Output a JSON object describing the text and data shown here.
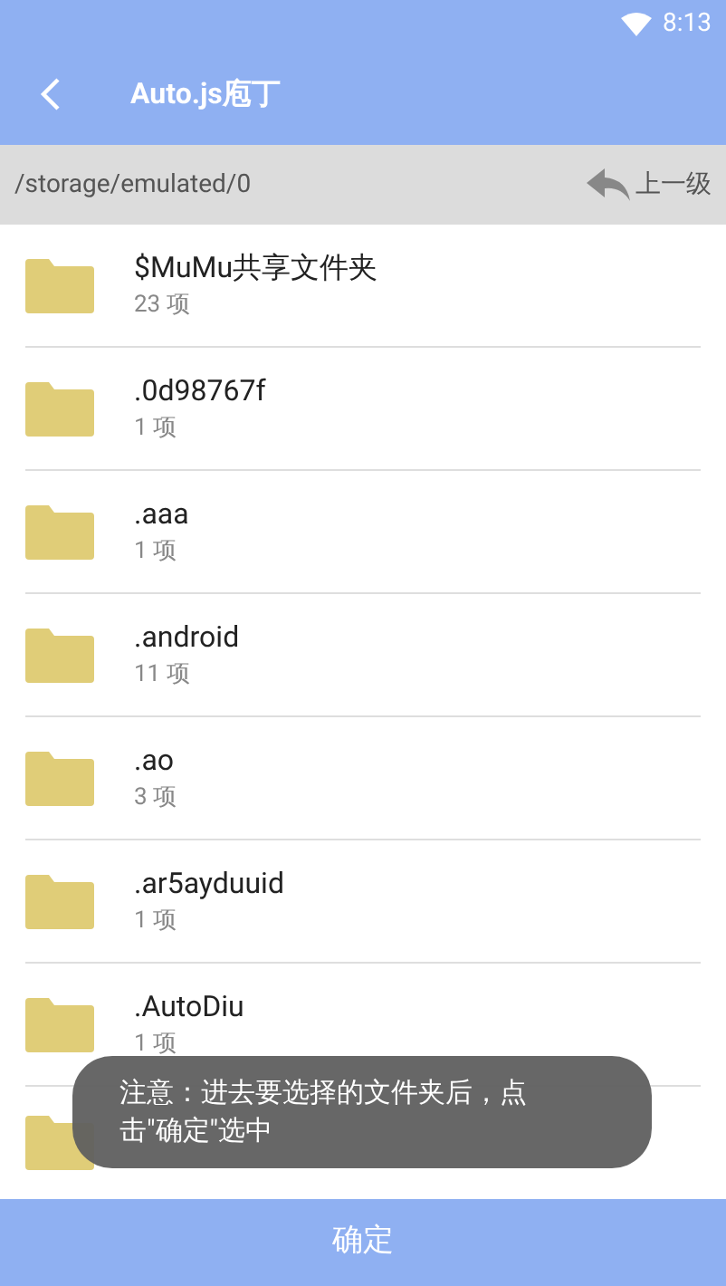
{
  "status_bar": {
    "time": "8:13"
  },
  "app_bar": {
    "title": "Auto.js庖丁"
  },
  "path_bar": {
    "path": "/storage/emulated/0",
    "up_label": "上一级"
  },
  "folders": [
    {
      "name": "$MuMu共享文件夹",
      "count": "23 项"
    },
    {
      "name": ".0d98767f",
      "count": "1 项"
    },
    {
      "name": ".aaa",
      "count": "1 项"
    },
    {
      "name": ".android",
      "count": "11 项"
    },
    {
      "name": ".ao",
      "count": "3 项"
    },
    {
      "name": ".ar5ayduuid",
      "count": "1 项"
    },
    {
      "name": ".AutoDiu",
      "count": "1 项"
    }
  ],
  "toast": {
    "text": "注意：进去要选择的文件夹后，点击\"确定\"选中"
  },
  "confirm_button": {
    "label": "确定"
  }
}
